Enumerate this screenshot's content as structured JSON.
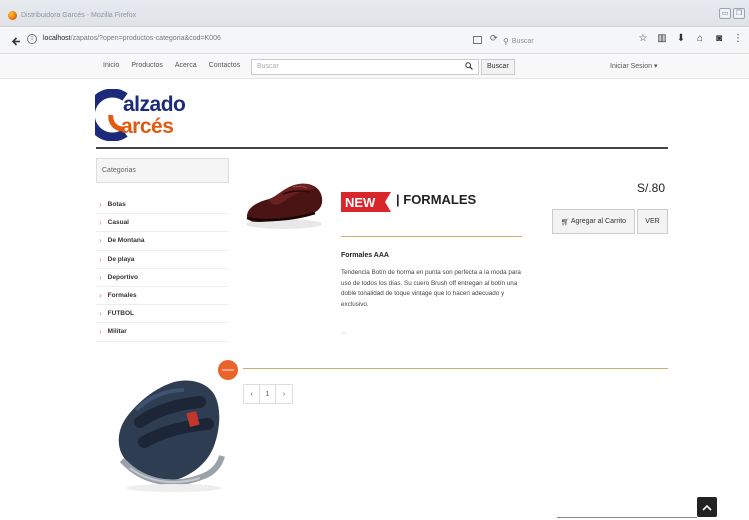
{
  "browser": {
    "window_title": "Distribuidora Garcés - Mozilla Firefox",
    "url_host": "localhost",
    "url_path": "/zapatos/?open=productos-categoria&cod=K006",
    "search_placeholder": "Buscar",
    "win_btn_min": "▭",
    "win_btn_restore": "❐"
  },
  "site": {
    "nav": [
      "Inicio",
      "Productos",
      "Acerca",
      "Contactos"
    ],
    "search_placeholder": "Buscar",
    "search_button": "Buscar",
    "login": "Iniciar Sesion ▾",
    "logo_line1": "alzado",
    "logo_line2": "arcés"
  },
  "sidebar": {
    "title": "Categorias",
    "items": [
      "Botas",
      "Casual",
      "De Montana",
      "De playa",
      "Deportivo",
      "Formales",
      "FUTBOL",
      "Militar"
    ]
  },
  "product": {
    "badge": "NEW",
    "category": "| FORMALES",
    "price": "S/.80",
    "cart_button": "Agregar al Carrito",
    "view_button": "VER",
    "name": "Formales AAA",
    "description": "Tendencia Botín de horma en punta son perfecta a la moda para uso de todos los días. Su cuero Brush off entregan al botín una doble tonalidad de toque vintage que lo hacen adecuado y exclusivo.",
    "ellipsis": "..."
  },
  "pagination": {
    "prev": "‹",
    "page": "1",
    "next": "›"
  },
  "colors": {
    "accent_orange": "#e2834e",
    "gold_rule": "#c9b26e",
    "logo_blue": "#1c2a7a",
    "logo_orange": "#e25a10",
    "badge_red": "#d9262b"
  }
}
